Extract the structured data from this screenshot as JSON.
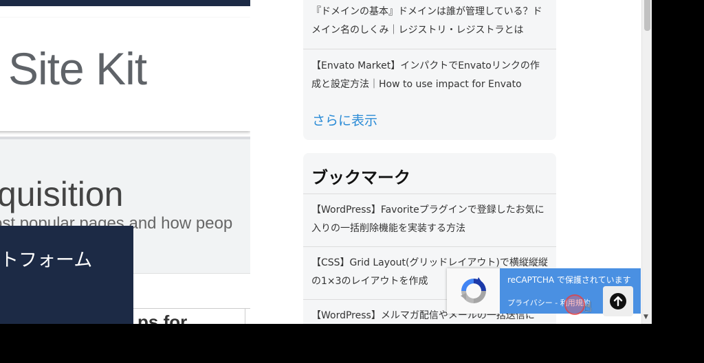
{
  "left_panel": {
    "site_kit_heading": "Site Kit",
    "acquisition_heading": "quisition",
    "acquisition_subtitle": "ost popular pages and how peop",
    "popup_text": "トフォーム",
    "lower_heading": "ps for"
  },
  "sidebar": {
    "widget1": {
      "items": [
        "『ドメインの基本』ドメインは誰が管理している？ドメイン名のしくみ｜レジストリ・レジストラとは",
        "【Envato Market】インパクトでEnvatoリンクの作成と設定方法｜How to use impact for Envato"
      ],
      "more_link": "さらに表示"
    },
    "widget2": {
      "title": "ブックマーク",
      "items": [
        "【WordPress】Favoriteプラグインで登録したお気に入りの一括削除機能を実装する方法",
        "【CSS】Grid Layout(グリッドレイアウト)で横縦縦縦の1×3のレイアウトを作成",
        "【WordPress】メルマガ配信やメールの一括送信に"
      ]
    }
  },
  "recaptcha": {
    "line1": "reCAPTCHA で保護されています",
    "line2": "プライバシー - 利用規約"
  },
  "icons": {
    "recaptcha_logo": "recaptcha-logo-icon",
    "back_to_top": "arrow-up-icon",
    "cursor": "hand-pointer-icon"
  },
  "colors": {
    "link": "#2a8bd6",
    "recaptcha_blue": "#4a90e2",
    "navy": "#1c2a45"
  }
}
